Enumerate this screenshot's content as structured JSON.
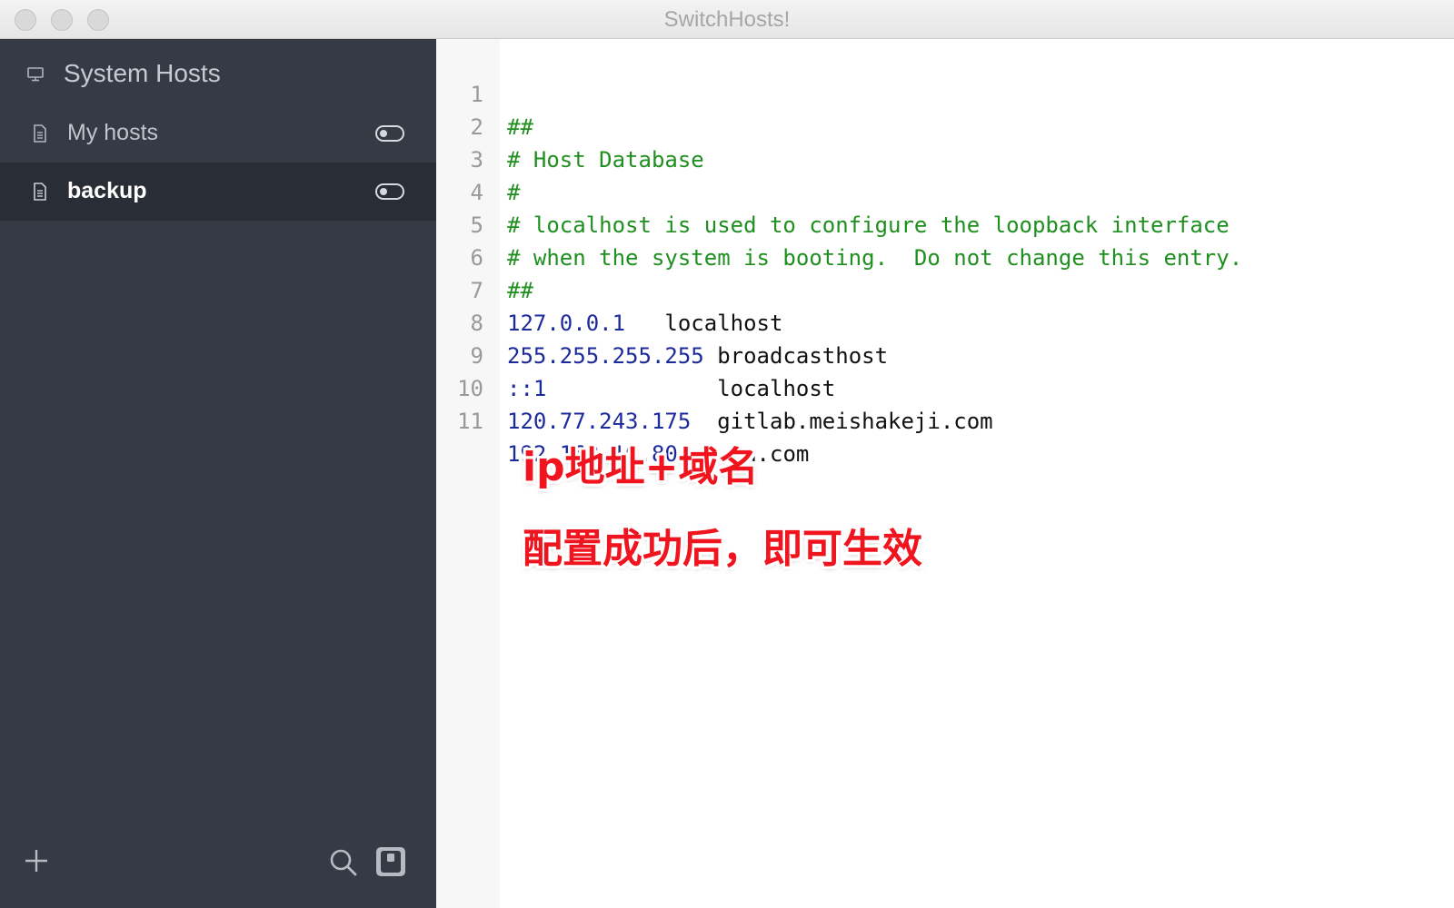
{
  "window": {
    "title": "SwitchHosts!"
  },
  "sidebar": {
    "items": [
      {
        "label": "System Hosts",
        "icon": "monitor-icon"
      },
      {
        "label": "My hosts",
        "icon": "document-icon",
        "toggle": "off"
      },
      {
        "label": "backup",
        "icon": "document-icon",
        "toggle": "off",
        "selected": true
      }
    ],
    "footer": {
      "add_icon": "plus-icon",
      "search_icon": "search-icon",
      "settings_icon": "switch-icon"
    }
  },
  "editor": {
    "lines": [
      {
        "num": "1",
        "comment": "##"
      },
      {
        "num": "2",
        "comment": "# Host Database"
      },
      {
        "num": "3",
        "comment": "#"
      },
      {
        "num": "4",
        "comment": "# localhost is used to configure the loopback interface"
      },
      {
        "num": "5",
        "comment": "# when the system is booting.  Do not change this entry."
      },
      {
        "num": "6",
        "comment": "##"
      },
      {
        "num": "7",
        "ip": "127.0.0.1",
        "host": "   localhost"
      },
      {
        "num": "8",
        "ip": "255.255.255.255",
        "host": " broadcasthost"
      },
      {
        "num": "9",
        "ip": "::1",
        "host": "             localhost"
      },
      {
        "num": "10",
        "ip": "120.77.243.175",
        "host": "  gitlab.meishakeji.com"
      },
      {
        "num": "11",
        "ip": "192.168.10.80",
        "host": " rp.oa.com"
      }
    ]
  },
  "annotations": {
    "line1": "ip地址+域名",
    "line2": "配置成功后，即可生效"
  },
  "colors": {
    "sidebar_bg": "#353a44",
    "sidebar_selected": "#292d35",
    "comment": "#1f8f1f",
    "ip": "#1d2a9c",
    "annotation": "#f0141e"
  }
}
